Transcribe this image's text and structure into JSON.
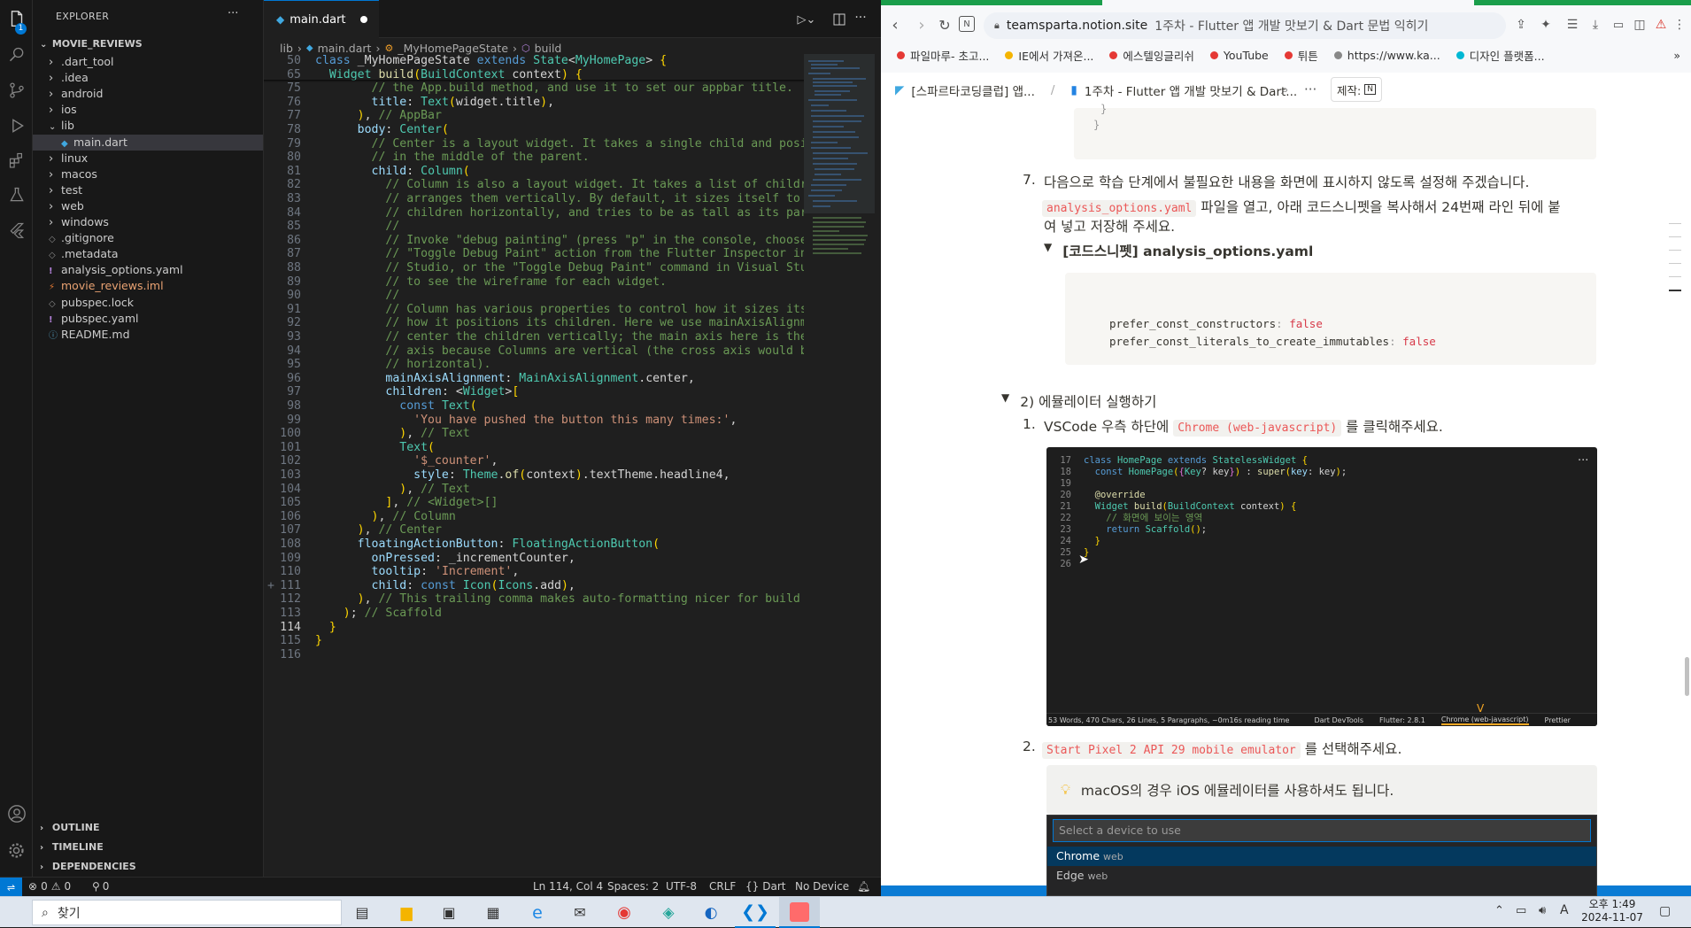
{
  "vscode": {
    "explorer": {
      "title": "EXPLORER",
      "more": "···",
      "project": "MOVIE_REVIEWS",
      "items": [
        {
          "label": ".dart_tool",
          "kind": "folder"
        },
        {
          "label": ".idea",
          "kind": "folder"
        },
        {
          "label": "android",
          "kind": "folder"
        },
        {
          "label": "ios",
          "kind": "folder"
        },
        {
          "label": "lib",
          "kind": "folder-open"
        },
        {
          "label": "main.dart",
          "kind": "dart-file"
        },
        {
          "label": "linux",
          "kind": "folder"
        },
        {
          "label": "macos",
          "kind": "folder"
        },
        {
          "label": "test",
          "kind": "folder"
        },
        {
          "label": "web",
          "kind": "folder"
        },
        {
          "label": "windows",
          "kind": "folder"
        },
        {
          "label": ".gitignore",
          "kind": "file"
        },
        {
          "label": ".metadata",
          "kind": "file"
        },
        {
          "label": "analysis_options.yaml",
          "kind": "yaml"
        },
        {
          "label": "movie_reviews.iml",
          "kind": "xml"
        },
        {
          "label": "pubspec.lock",
          "kind": "file"
        },
        {
          "label": "pubspec.yaml",
          "kind": "yaml"
        },
        {
          "label": "README.md",
          "kind": "info"
        }
      ],
      "sections": [
        "OUTLINE",
        "TIMELINE",
        "DEPENDENCIES"
      ],
      "badge": "1"
    },
    "tab": {
      "label": "main.dart"
    },
    "breadcrumbs": [
      "lib",
      "main.dart",
      "_MyHomePageState",
      "build"
    ],
    "sticky": [
      {
        "n": "50",
        "t": "class _MyHomePageState extends State<MyHomePage> {"
      },
      {
        "n": "65",
        "t": "  Widget build(BuildContext context) {"
      }
    ],
    "lines": [
      {
        "n": "75",
        "t": "        // the App.build method, and use it to set our appbar title."
      },
      {
        "n": "76",
        "t": "        title: Text(widget.title),"
      },
      {
        "n": "77",
        "t": "      ), // AppBar"
      },
      {
        "n": "78",
        "t": "      body: Center("
      },
      {
        "n": "79",
        "t": "        // Center is a layout widget. It takes a single child and posi"
      },
      {
        "n": "80",
        "t": "        // in the middle of the parent."
      },
      {
        "n": "81",
        "t": "        child: Column("
      },
      {
        "n": "82",
        "t": "          // Column is also a layout widget. It takes a list of childr"
      },
      {
        "n": "83",
        "t": "          // arranges them vertically. By default, it sizes itself to"
      },
      {
        "n": "84",
        "t": "          // children horizontally, and tries to be as tall as its par"
      },
      {
        "n": "85",
        "t": "          //"
      },
      {
        "n": "86",
        "t": "          // Invoke \"debug painting\" (press \"p\" in the console, choose"
      },
      {
        "n": "87",
        "t": "          // \"Toggle Debug Paint\" action from the Flutter Inspector in"
      },
      {
        "n": "88",
        "t": "          // Studio, or the \"Toggle Debug Paint\" command in Visual Stu"
      },
      {
        "n": "89",
        "t": "          // to see the wireframe for each widget."
      },
      {
        "n": "90",
        "t": "          //"
      },
      {
        "n": "91",
        "t": "          // Column has various properties to control how it sizes its"
      },
      {
        "n": "92",
        "t": "          // how it positions its children. Here we use mainAxisAlignm"
      },
      {
        "n": "93",
        "t": "          // center the children vertically; the main axis here is the"
      },
      {
        "n": "94",
        "t": "          // axis because Columns are vertical (the cross axis would b"
      },
      {
        "n": "95",
        "t": "          // horizontal)."
      },
      {
        "n": "96",
        "t": "          mainAxisAlignment: MainAxisAlignment.center,"
      },
      {
        "n": "97",
        "t": "          children: <Widget>["
      },
      {
        "n": "98",
        "t": "            const Text("
      },
      {
        "n": "99",
        "t": "              'You have pushed the button this many times:',"
      },
      {
        "n": "100",
        "t": "            ), // Text"
      },
      {
        "n": "101",
        "t": "            Text("
      },
      {
        "n": "102",
        "t": "              '$_counter',"
      },
      {
        "n": "103",
        "t": "              style: Theme.of(context).textTheme.headline4,"
      },
      {
        "n": "104",
        "t": "            ), // Text"
      },
      {
        "n": "105",
        "t": "          ], // <Widget>[]"
      },
      {
        "n": "106",
        "t": "        ), // Column"
      },
      {
        "n": "107",
        "t": "      ), // Center"
      },
      {
        "n": "108",
        "t": "      floatingActionButton: FloatingActionButton("
      },
      {
        "n": "109",
        "t": "        onPressed: _incrementCounter,"
      },
      {
        "n": "110",
        "t": "        tooltip: 'Increment',"
      },
      {
        "n": "111",
        "t": "        child: const Icon(Icons.add),"
      },
      {
        "n": "112",
        "t": "      ), // This trailing comma makes auto-formatting nicer for build"
      },
      {
        "n": "113",
        "t": "    ); // Scaffold"
      },
      {
        "n": "114",
        "t": "  }"
      },
      {
        "n": "115",
        "t": "}"
      },
      {
        "n": "116",
        "t": ""
      }
    ],
    "active_line": "114",
    "added_marker": "+",
    "status": {
      "errors": "0",
      "warnings": "0",
      "ports": "0",
      "position": "Ln 114, Col 4",
      "spaces": "Spaces: 2",
      "encoding": "UTF-8",
      "eol": "CRLF",
      "language": "Dart",
      "device": "No Device"
    }
  },
  "browser": {
    "url_host": "teamsparta.notion.site",
    "url_title": "1주차 - Flutter 앱 개발 맛보기 & Dart 문법 익히기",
    "bookmarks": [
      "파일마루- 초고...",
      "IE에서 가져온...",
      "에스텔잉글리쉬",
      "YouTube",
      "튀튼",
      "https://www.ka...",
      "디자인 플랫폼..."
    ],
    "bookmark_colors": [
      "#e53935",
      "#f4b400",
      "#e53935",
      "#e53935",
      "#e53935",
      "#888888",
      "#00b8d4"
    ],
    "breadcrumb": [
      "[스파르타코딩클럽] 앱...",
      "1주차 - Flutter 앱 개발 맛보기 & Dart..."
    ],
    "breadcrumb_sep": "/",
    "make_button": "제작:",
    "page": {
      "closing_brace": "}",
      "step7_num": "7.",
      "step7_text": "다음으로 학습 단계에서 불필요한 내용을 화면에 표시하지 않도록 설정해 주겠습니다.",
      "step7_code": "analysis_options.yaml",
      "step7_cont1": " 파일을 열고, 아래 코드스니펫을 복사해서 24번째 라인 뒤에 붙",
      "step7_cont2": "여 넣고 저장해 주세요.",
      "toggle_label": "[코드스니펫] analysis_options.yaml",
      "yaml_lines": [
        {
          "key": "prefer_const_constructors",
          "val": "false"
        },
        {
          "key": "prefer_const_literals_to_create_immutables",
          "val": "false"
        }
      ],
      "section2": "2) 에뮬레이터 실행하기",
      "step1_num": "1.",
      "step1_a": "VSCode 우측 하단에 ",
      "step1_code": "Chrome (web-javascript)",
      "step1_b": " 를 클릭해주세요.",
      "step2_num": "2.",
      "step2_code": "Start Pixel 2 API 29 mobile emulator",
      "step2_b": " 를 선택해주세요.",
      "callout": "macOS의 경우 iOS 에뮬레이터를 사용하셔도 됩니다.",
      "picker_placeholder": "Select a device to use",
      "picker_items": [
        {
          "name": "Chrome",
          "kind": "web"
        },
        {
          "name": "Edge",
          "kind": "web"
        }
      ]
    },
    "screenshot": {
      "lines": [
        {
          "n": "17",
          "t": "class HomePage extends StatelessWidget {"
        },
        {
          "n": "18",
          "t": "  const HomePage({Key? key}) : super(key: key);"
        },
        {
          "n": "19",
          "t": ""
        },
        {
          "n": "20",
          "t": "  @override"
        },
        {
          "n": "21",
          "t": "  Widget build(BuildContext context) {"
        },
        {
          "n": "22",
          "t": "    // 화면에 보이는 영역"
        },
        {
          "n": "23",
          "t": "    return Scaffold();"
        },
        {
          "n": "24",
          "t": "  }"
        },
        {
          "n": "25",
          "t": "}"
        },
        {
          "n": "26",
          "t": ""
        }
      ],
      "status_left": "53 Words, 470 Chars, 26 Lines, 5 Paragraphs, ~0m16s reading time",
      "status_items": [
        "Dart DevTools",
        "Flutter: 2.8.1",
        "Chrome (web-javascript)",
        "Prettier"
      ]
    }
  },
  "taskbar": {
    "search": "찾기",
    "clock_time": "오후 1:49",
    "clock_date": "2024-11-07",
    "ime": "A"
  }
}
